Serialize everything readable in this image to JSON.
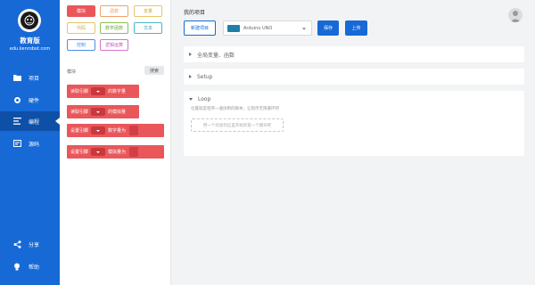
{
  "colors": {
    "sidebar": "#1769d6",
    "accent": "#1769d6",
    "block_red": "#e9575b"
  },
  "sidebar": {
    "brand_title": "教育版",
    "brand_url": "edu.kenrobot.com",
    "nav": [
      {
        "label": "项目",
        "icon": "folder-icon",
        "active": false
      },
      {
        "label": "硬件",
        "icon": "chip-icon",
        "active": false
      },
      {
        "label": "编程",
        "icon": "code-icon",
        "active": true
      },
      {
        "label": "源码",
        "icon": "source-icon",
        "active": false
      }
    ],
    "bottom": [
      {
        "label": "分享",
        "icon": "share-icon"
      },
      {
        "label": "帮助",
        "icon": "bulb-icon"
      }
    ]
  },
  "palette": {
    "categories": [
      {
        "label": "模块",
        "color": "#e9575b",
        "filled": true
      },
      {
        "label": "函数",
        "color": "#f0a36b",
        "filled": false
      },
      {
        "label": "变量",
        "color": "#e9c46a",
        "filled": false
      },
      {
        "label": "代码",
        "color": "#e9c46a",
        "filled": false
      },
      {
        "label": "数学函数",
        "color": "#8cc152",
        "filled": false
      },
      {
        "label": "文本",
        "color": "#48b5c4",
        "filled": false
      },
      {
        "label": "控制",
        "color": "#4a8ee8",
        "filled": false
      },
      {
        "label": "逻辑运算",
        "color": "#d672c8",
        "filled": false
      }
    ],
    "section_label": "模块",
    "search_label": "搜索",
    "blocks": [
      {
        "pre": "读取引脚",
        "post": "的数字量"
      },
      {
        "pre": "读取引脚",
        "post": "的模拟量"
      },
      {
        "pre": "设置引脚",
        "post": "数字量为"
      },
      {
        "pre": "设置引脚",
        "post": "模拟量为"
      }
    ]
  },
  "main": {
    "project_label": "我的项目",
    "new_project": "新建项目",
    "board": "Arduino UNO",
    "save": "保存",
    "upload": "上传",
    "sections": [
      {
        "title": "全局变量、函数"
      },
      {
        "title": "Setup"
      },
      {
        "title": "Loop",
        "desc": "位置就是程序一遍仿制的脚本，让程序无限循环吧",
        "drop_hint": "用一个块放到这里开始的第一个模块吧"
      }
    ]
  }
}
